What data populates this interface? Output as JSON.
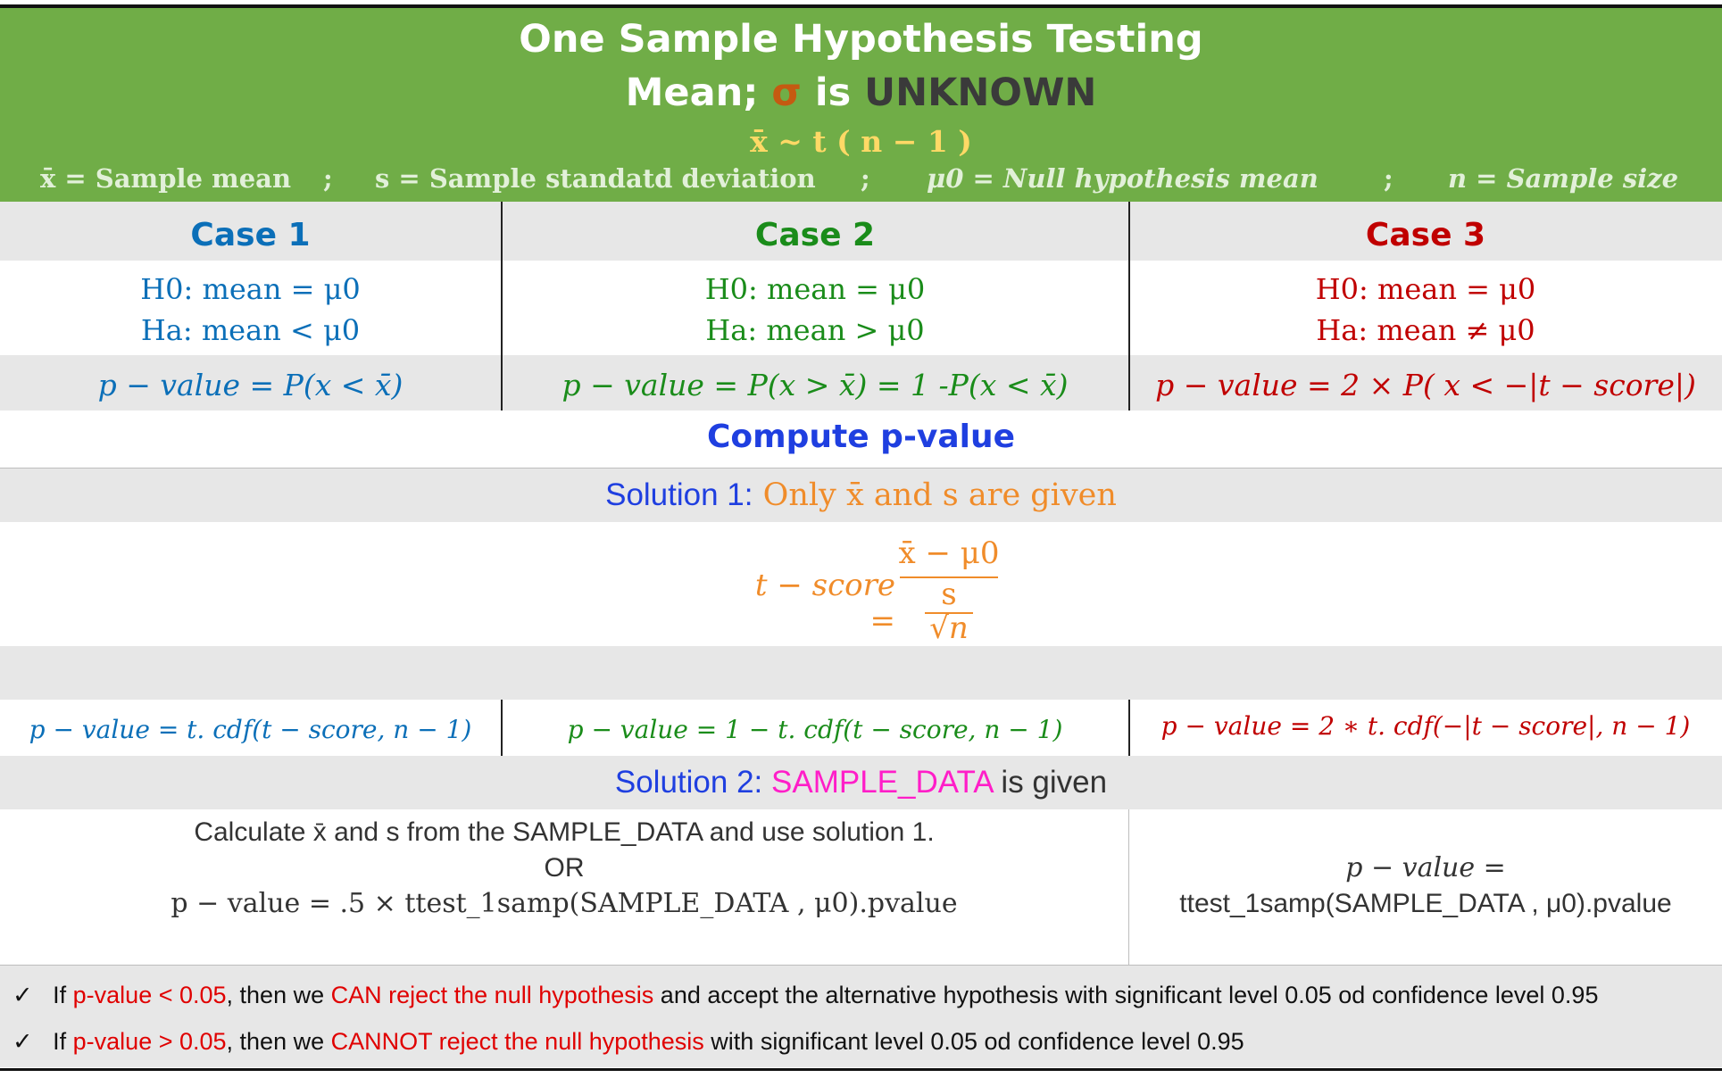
{
  "header": {
    "title_line1": "One Sample Hypothesis Testing",
    "title_line2_a": "Mean; ",
    "title_line2_sigma": "σ",
    "title_line2_b": " is ",
    "title_line2_c": "UNKNOWN",
    "distribution": "x̄ ~ t ( n − 1 )",
    "def_xbar": "x̄ = Sample mean",
    "def_s": "s = Sample standatd deviation",
    "def_mu": "μ0 = Null hypothesis mean",
    "def_n": "n = Sample size",
    "sep": ";"
  },
  "cases": [
    {
      "title": "Case 1",
      "h0": "H0:  mean = μ0",
      "ha": "Ha:  mean < μ0",
      "pvalue": "p − value  =  P(x  < x̄)"
    },
    {
      "title": "Case 2",
      "h0": "H0:  mean = μ0",
      "ha": "Ha:  mean > μ0",
      "pvalue": "p − value  = P(x >  x̄) = 1 -P(x  < x̄)"
    },
    {
      "title": "Case 3",
      "h0": "H0:  mean = μ0",
      "ha": "Ha:  mean ≠ μ0",
      "pvalue": "p − value  = 2 × P( x < −|t − score|)"
    }
  ],
  "compute_title": "Compute p-value",
  "solution1": {
    "label": "Solution 1:",
    "text": " Only x̄ and s are given",
    "tscore_lhs": "t − score =",
    "numerator": "x̄ − μ0",
    "denominator_top": "s",
    "denominator_bottom": "√n",
    "formulas": [
      "p − value  = t. cdf(t − score, n − 1)",
      "p − value  = 1  − t. cdf(t − score, n − 1)",
      "p − value  = 2  ∗ t. cdf(−|t − score|, n − 1)"
    ]
  },
  "solution2": {
    "label": "Solution 2:",
    "data_name": " SAMPLE_DATA",
    "text": " is given",
    "left_line1": "Calculate x̄ and s from the SAMPLE_DATA and use solution 1.",
    "left_line2": "OR",
    "left_line3": "p − value = .5 × ttest_1samp(SAMPLE_DATA , μ0).pvalue",
    "right_line1": "p − value =",
    "right_line2": "ttest_1samp(SAMPLE_DATA , μ0).pvalue"
  },
  "notes": [
    {
      "a": "If ",
      "b": "p-value < 0.05",
      "c": ", then we ",
      "d": "CAN reject the null hypothesis",
      "e": " and accept the alternative hypothesis  with significant level 0.05 od confidence level 0.95"
    },
    {
      "a": "If ",
      "b": "p-value > 0.05",
      "c": ", then we ",
      "d": "CANNOT reject the null hypothesis",
      "e": " with significant level 0.05 od confidence level 0.95"
    }
  ],
  "check_icon": "✓",
  "colors": {
    "header_green": "#70ad47",
    "case1": "#0b6fb8",
    "case2": "#1a8c1a",
    "case3": "#c00000",
    "blue": "#1f3fe0",
    "orange": "#f08c2a",
    "pink": "#ff1ec8",
    "red": "#e00000"
  }
}
